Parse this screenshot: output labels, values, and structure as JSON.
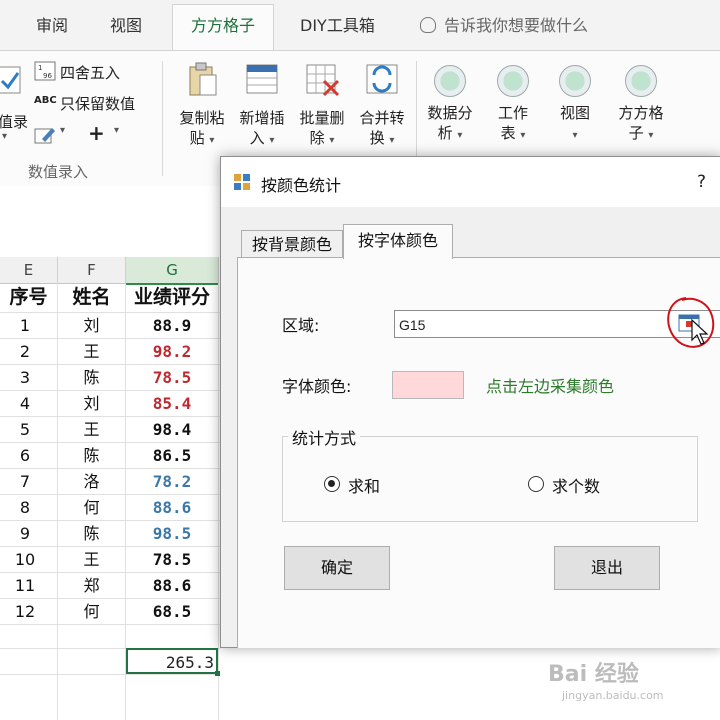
{
  "ribbon": {
    "tabs": [
      "审阅",
      "视图",
      "方方格子",
      "DIY工具箱"
    ],
    "active_tab": "方方格子",
    "tell_me": "告诉我你想要做什么",
    "round_label": "四舍五入",
    "keep_values_label": "只保留数值",
    "entry_partial": "值录",
    "group_caption": "数值录入",
    "buttons": [
      {
        "line1": "复制粘",
        "line2": "贴"
      },
      {
        "line1": "新增插",
        "line2": "入"
      },
      {
        "line1": "批量删",
        "line2": "除"
      },
      {
        "line1": "合并转",
        "line2": "换"
      },
      {
        "line1": "数据分",
        "line2": "析"
      },
      {
        "line1": "工作",
        "line2": "表"
      },
      {
        "line1": "视图",
        "line2": ""
      },
      {
        "line1": "方方格",
        "line2": "子"
      }
    ]
  },
  "sheet": {
    "columns": [
      "E",
      "F",
      "G"
    ],
    "selected_column": "G",
    "headers": [
      "序号",
      "姓名",
      "业绩评分"
    ],
    "rows": [
      {
        "no": "1",
        "name": "刘",
        "score": "88.9",
        "color": "#111111"
      },
      {
        "no": "2",
        "name": "王",
        "score": "98.2",
        "color": "#c0282d"
      },
      {
        "no": "3",
        "name": "陈",
        "score": "78.5",
        "color": "#c0282d"
      },
      {
        "no": "4",
        "name": "刘",
        "score": "85.4",
        "color": "#c0282d"
      },
      {
        "no": "5",
        "name": "王",
        "score": "98.4",
        "color": "#111111"
      },
      {
        "no": "6",
        "name": "陈",
        "score": "86.5",
        "color": "#111111"
      },
      {
        "no": "7",
        "name": "洛",
        "score": "78.2",
        "color": "#3a78a8"
      },
      {
        "no": "8",
        "name": "何",
        "score": "88.6",
        "color": "#3a78a8"
      },
      {
        "no": "9",
        "name": "陈",
        "score": "98.5",
        "color": "#3a78a8"
      },
      {
        "no": "10",
        "name": "王",
        "score": "78.5",
        "color": "#111111"
      },
      {
        "no": "11",
        "name": "郑",
        "score": "88.6",
        "color": "#111111"
      },
      {
        "no": "12",
        "name": "何",
        "score": "68.5",
        "color": "#111111"
      }
    ],
    "sum_value": "265.3"
  },
  "dialog": {
    "title": "按颜色统计",
    "help": "?",
    "tabs": [
      "按背景颜色",
      "按字体颜色"
    ],
    "active_tab": "按字体颜色",
    "range_label": "区域:",
    "range_value": "G15",
    "font_color_label": "字体颜色:",
    "font_color_value": "#ffd9d9",
    "hint": "点击左边采集颜色",
    "stat_method_label": "统计方式",
    "options": [
      "求和",
      "求个数"
    ],
    "selected_option": "求和",
    "ok_label": "确定",
    "exit_label": "退出"
  },
  "watermark": {
    "text": "Bai 经验",
    "sub": "jingyan.baidu.com"
  }
}
